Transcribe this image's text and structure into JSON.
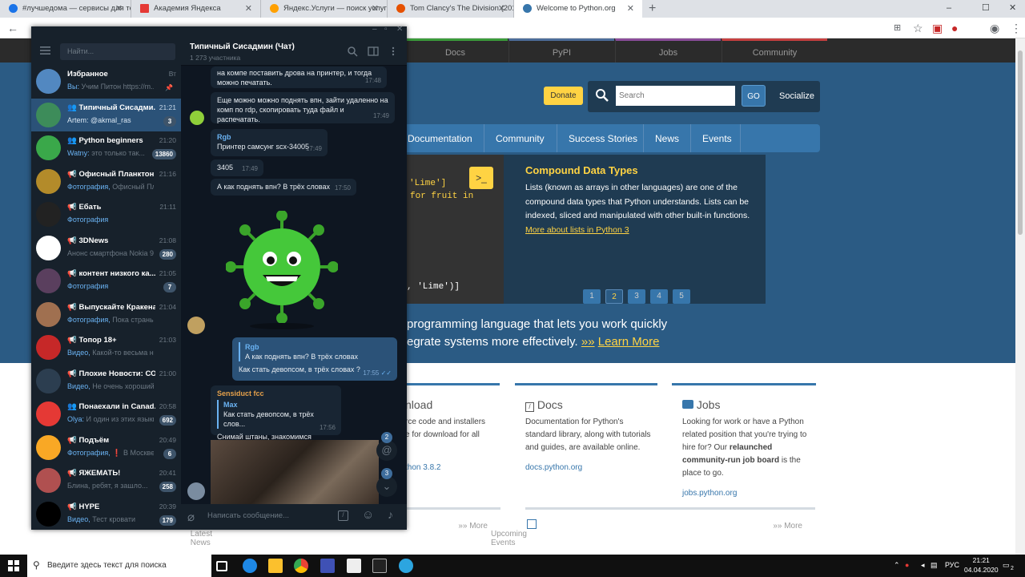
{
  "browser": {
    "tabs": [
      {
        "title": "#лучшедома — сервисы для те",
        "color": "#1a73e8"
      },
      {
        "title": "Академия Яндекса",
        "color": "#e53935"
      },
      {
        "title": "Яндекс.Услуги — поиск услуг и",
        "color": "#ffa000"
      },
      {
        "title": "Tom Clancy's The Division (2016)",
        "color": "#e65100"
      },
      {
        "title": "Welcome to Python.org",
        "color": "#3776ab"
      }
    ],
    "window_controls": {
      "minimize": "–",
      "maximize": "☐",
      "close": "✕"
    }
  },
  "python": {
    "top_nav": [
      {
        "label": "Docs",
        "color": "#3b9b3b"
      },
      {
        "label": "PyPI",
        "color": "#4d6d9a"
      },
      {
        "label": "Jobs",
        "color": "#8b4d9a"
      },
      {
        "label": "Community",
        "color": "#c64040"
      }
    ],
    "donate": "Donate",
    "search_placeholder": "Search",
    "go": "GO",
    "socialize": "Socialize",
    "nav": [
      "Documentation",
      "Community",
      "Success Stories",
      "News",
      "Events"
    ],
    "code_lines": [
      "'Lime']",
      "for fruit in",
      ", 'Lime')]"
    ],
    "shell_icon": ">_",
    "feature": {
      "title": "Compound Data Types",
      "text": "Lists (known as arrays in other languages) are one of the compound data types that Python understands. Lists can be indexed, sliced and manipulated with other built-in functions.",
      "link": "More about lists in Python 3"
    },
    "pages": [
      "1",
      "2",
      "3",
      "4",
      "5"
    ],
    "active_page": "2",
    "tagline_1": "programming language that lets you work quickly",
    "tagline_2": "egrate systems more effectively.",
    "learn_more_arrows": "»»",
    "learn_more": "Learn More",
    "columns": [
      {
        "title": "nload",
        "text": "rce code and installers\ne for download for all",
        "link": "thon 3.8.2"
      },
      {
        "title": "Docs",
        "text": "Documentation for Python's\nstandard library, along with tutorials\nand guides, are available online.",
        "link": "docs.python.org"
      },
      {
        "title": "Jobs",
        "text_1": "Looking for work or have a Python\nrelated position that you're trying to\nhire for? Our ",
        "text_bold": "relaunched\ncommunity-run job board",
        "text_2": " is the\nplace to go.",
        "link": "jobs.python.org"
      }
    ],
    "bottom": [
      {
        "title": "Latest News",
        "more": "»» More"
      },
      {
        "title": "Upcoming Events",
        "more": "»» More"
      }
    ]
  },
  "telegram": {
    "search_placeholder": "Найти...",
    "chats": [
      {
        "name": "Избранное",
        "time": "Вт",
        "prev_hl": "Вы: ",
        "prev": "Учим Питон https://m...",
        "badge": "",
        "avatar": "#5288c1",
        "pinned": true
      },
      {
        "name": "Типичный Сисадми...",
        "time": "21:21",
        "prev_hl": "",
        "prev": "Artem: @akmal_ras",
        "badge": "3",
        "avatar": "#3d8c5a",
        "selected": true,
        "group": true
      },
      {
        "name": "Python beginners",
        "time": "21:20",
        "prev_hl": "Watny: ",
        "prev": "это только  так...",
        "badge": "13860",
        "avatar": "#3aa84a",
        "group": true
      },
      {
        "name": "Офисный Планктон",
        "time": "21:16",
        "prev_hl": "Фотография, ",
        "prev": "Офисный Планкт...",
        "badge": "",
        "avatar": "#b38b2a",
        "channel": true
      },
      {
        "name": "Ебать",
        "time": "21:11",
        "prev_hl": "Фотография",
        "prev": "",
        "badge": "",
        "avatar": "#222222",
        "channel": true
      },
      {
        "name": "3DNews",
        "time": "21:08",
        "prev_hl": "",
        "prev": "Анонс смартфона Nokia 9...",
        "badge": "280",
        "avatar": "#ffffff",
        "channel": true
      },
      {
        "name": "контент низкого ка...",
        "time": "21:05",
        "prev_hl": "Фотография",
        "prev": "",
        "badge": "7",
        "avatar": "#5a3f5e",
        "channel": true
      },
      {
        "name": "Выпускайте Кракена!",
        "time": "21:04",
        "prev_hl": "Фотография, ",
        "prev": "Пока страны изол...",
        "badge": "",
        "avatar": "#a07050",
        "channel": true
      },
      {
        "name": "Топор 18+",
        "time": "21:03",
        "prev_hl": "Видео, ",
        "prev": "Какой-то весьма нервн...",
        "badge": "",
        "avatar": "#c62828",
        "channel": true
      },
      {
        "name": "Плохие Новости: СО...",
        "time": "21:00",
        "prev_hl": "Видео, ",
        "prev": "Не очень хороший год ...",
        "badge": "",
        "avatar": "#2c3e50",
        "channel": true
      },
      {
        "name": "Понаехали in Canad...",
        "time": "20:58",
        "prev_hl": "Olya: ",
        "prev": "И один из этих языкк...",
        "badge": "692",
        "avatar": "#e53935",
        "group": true
      },
      {
        "name": "Подъём",
        "time": "20:49",
        "prev_hl": "Фотография, ",
        "prev": "❗ В Москве ...",
        "badge": "6",
        "avatar": "#f9a825",
        "channel": true
      },
      {
        "name": "ЯЖЕМАТЬ!",
        "time": "20:41",
        "prev_hl": "",
        "prev": "Блина, ребят, я зашло...",
        "badge": "258",
        "avatar": "#b05050",
        "channel": true
      },
      {
        "name": "HYPE",
        "time": "20:39",
        "prev_hl": "Видео, ",
        "prev": "Тест кровати",
        "badge": "179",
        "avatar": "#000000",
        "channel": true
      }
    ],
    "chat_title": "Типичный Сисадмин (Чат)",
    "chat_members": "1 273 участника",
    "messages": [
      {
        "text": "на компе поставить дрова на принтер, и тогда можно печатать.",
        "time": "17:48"
      },
      {
        "text": "Еще можно можно поднять впн, зайти удаленно на комп по rdp, скопировать туда файл и распечатать.",
        "time": "17:49"
      },
      {
        "author": "Rgb",
        "text": "Принтер самсунг scx-34005",
        "time": "17:49"
      },
      {
        "text": "3405",
        "time": "17:49"
      },
      {
        "text": "А как поднять впн? В трёх словах",
        "time": "17:50"
      },
      {
        "reply_name": "Rgb",
        "reply_text": "А как поднять впн? В трёх словах",
        "text": "Как стать девопсом, в трёх словах ?",
        "time": "17:55"
      },
      {
        "author": "Sensiduct fcc",
        "reply_name": "Max",
        "reply_text": "Как стать девопсом, в трёх слов...",
        "text": "Снимай штаны, знакомимся",
        "time": "17:56"
      }
    ],
    "input_placeholder": "Написать сообщение...",
    "mentions_badge": "2",
    "down_badge": "3"
  },
  "taskbar": {
    "search_placeholder": "Введите здесь текст для поиска",
    "lang": "РУС",
    "time": "21:21",
    "date": "04.04.2020",
    "notify": "2"
  }
}
